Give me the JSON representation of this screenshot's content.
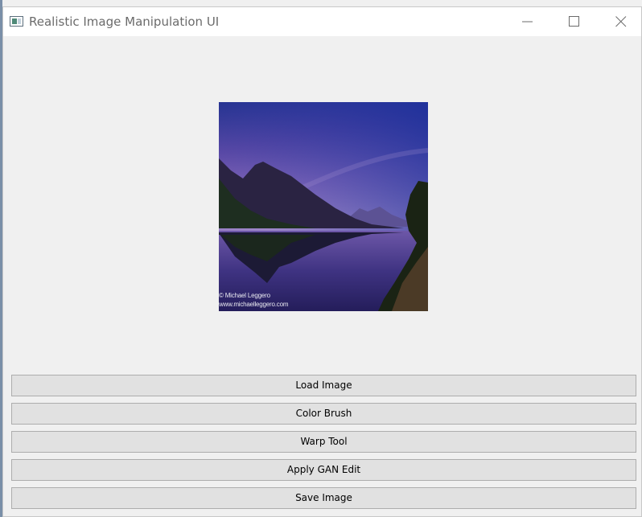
{
  "window": {
    "title": "Realistic Image Manipulation UI",
    "controls": {
      "minimize": "minimize-icon",
      "maximize": "maximize-icon",
      "close": "close-icon"
    }
  },
  "image": {
    "credit_line1": "© Michael Leggero",
    "credit_line2": "www.michaelleggero.com"
  },
  "buttons": [
    {
      "label": "Load Image"
    },
    {
      "label": "Color Brush"
    },
    {
      "label": "Warp Tool"
    },
    {
      "label": "Apply GAN Edit"
    },
    {
      "label": "Save Image"
    }
  ],
  "colors": {
    "window_bg": "#f0f0f0",
    "button_bg": "#e1e1e1",
    "button_border": "#adadad",
    "sky_top": "#1f3a96",
    "sky_mid": "#7a5aae"
  }
}
